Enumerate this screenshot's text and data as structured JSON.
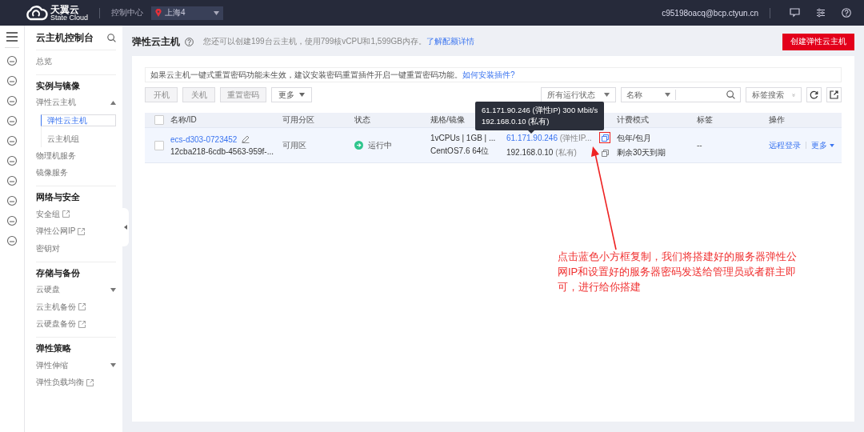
{
  "top_bar": {
    "logo_name": "天翼云",
    "logo_sub": "State Cloud",
    "console_link": "控制中心",
    "region": "上海4",
    "account": "c95198oacq@bcp.ctyun.cn"
  },
  "sidebar": {
    "title": "云主机控制台",
    "sections": [
      {
        "items": [
          {
            "label": "总览",
            "kind": "plain",
            "selected": false
          }
        ]
      },
      {
        "heading": "实例与镜像",
        "items": [
          {
            "label": "弹性云主机",
            "kind": "group",
            "expanded": true,
            "selected": false,
            "children": [
              {
                "label": "弹性云主机",
                "selected": true
              },
              {
                "label": "云主机组",
                "selected": false
              }
            ]
          },
          {
            "label": "物理机服务",
            "kind": "plain",
            "selected": false
          },
          {
            "label": "镜像服务",
            "kind": "plain",
            "selected": false
          }
        ]
      },
      {
        "heading": "网络与安全",
        "items": [
          {
            "label": "安全组",
            "kind": "external",
            "selected": false
          },
          {
            "label": "弹性公网IP",
            "kind": "external",
            "selected": false
          },
          {
            "label": "密钥对",
            "kind": "plain",
            "selected": false
          }
        ]
      },
      {
        "heading": "存储与备份",
        "items": [
          {
            "label": "云硬盘",
            "kind": "group",
            "expanded": false,
            "selected": false
          },
          {
            "label": "云主机备份",
            "kind": "external",
            "selected": false
          },
          {
            "label": "云硬盘备份",
            "kind": "external",
            "selected": false
          }
        ]
      },
      {
        "heading": "弹性策略",
        "items": [
          {
            "label": "弹性伸缩",
            "kind": "group",
            "expanded": false,
            "selected": false
          },
          {
            "label": "弹性负载均衡",
            "kind": "external",
            "selected": false
          }
        ]
      }
    ]
  },
  "page": {
    "title": "弹性云主机",
    "quota_note": "您还可以创建199台云主机，使用799核vCPU和1,599GB内存。",
    "quota_link": "了解配额详情",
    "create_button": "创建弹性云主机"
  },
  "notice": {
    "text": "如果云主机一键式重置密码功能未生效，建议安装密码重置插件开启一键重置密码功能。",
    "link": "如何安装插件?"
  },
  "actions": [
    {
      "label": "开机",
      "kind": "button",
      "disabled": true
    },
    {
      "label": "关机",
      "kind": "button",
      "disabled": true
    },
    {
      "label": "重置密码",
      "kind": "button",
      "disabled": true
    },
    {
      "label": "更多",
      "kind": "dropdown",
      "disabled": false
    }
  ],
  "filters": {
    "status_select": "所有运行状态",
    "field_select": "名称",
    "tag_search": "标签搜索"
  },
  "table": {
    "all_checked": false,
    "columns": [
      "名称/ID",
      "可用分区",
      "状态",
      "规格/镜像",
      "计费模式",
      "标签",
      "操作"
    ],
    "rows": [
      {
        "checked": false,
        "name": "ecs-d303-0723452",
        "id": "12cba218-6cdb-4563-959f-...",
        "zone": "可用区",
        "status": "运行中",
        "spec": "1vCPUs | 1GB | ...",
        "image": "CentOS7.6 64位",
        "public_ip": "61.171.90.246",
        "public_ip_note": "(弹性IP...",
        "public_copy_highlighted": true,
        "private_ip": "192.168.0.10",
        "private_ip_note": "(私有)",
        "private_copy_highlighted": false,
        "billing": "包年/包月",
        "expiry": "剩余30天到期",
        "tags": "--",
        "actions": [
          "远程登录",
          "更多"
        ]
      }
    ]
  },
  "tooltip": {
    "lines": [
      "61.171.90.246 (弹性IP) 300 Mbit/s",
      "192.168.0.10 (私有)"
    ]
  },
  "annotation": {
    "text": "点击蓝色小方框复制，我们将搭建好的服务器弹性公网IP和设置好的服务器密码发送给管理员或者群主即可，进行给你搭建"
  }
}
